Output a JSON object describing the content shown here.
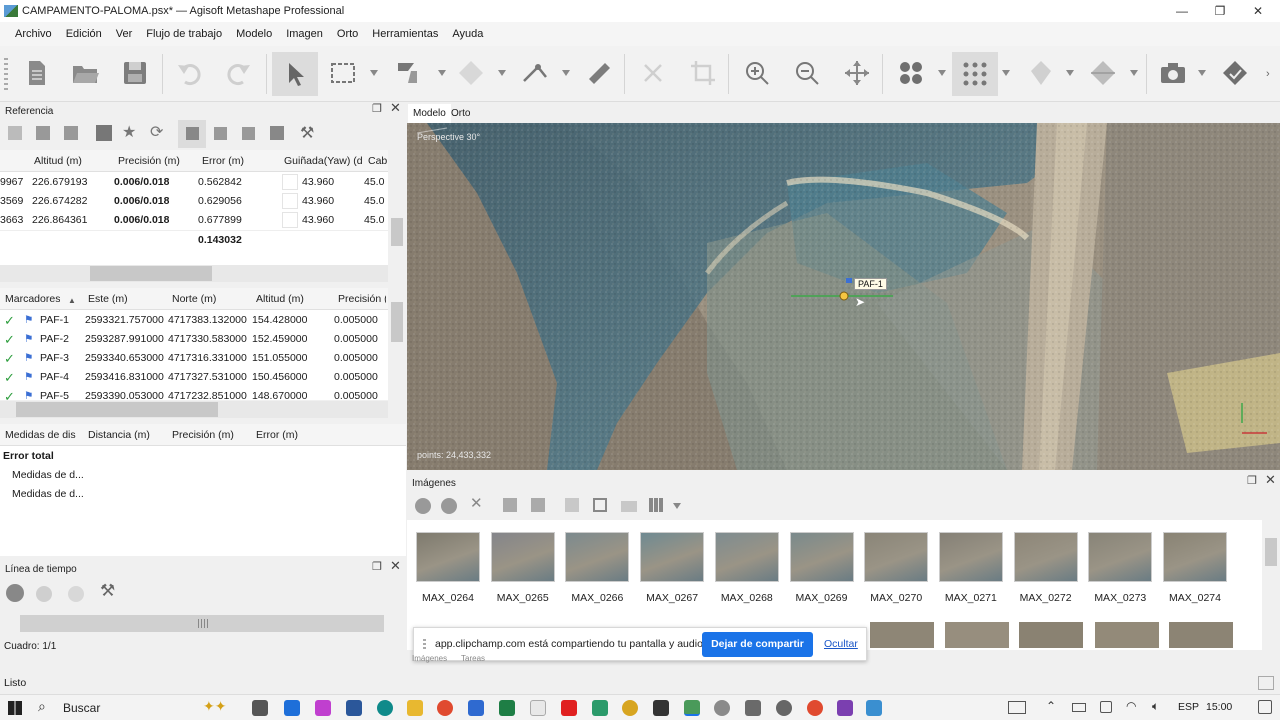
{
  "window": {
    "title": "CAMPAMENTO-PALOMA.psx* — Agisoft Metashape Professional",
    "minimize": "—",
    "maximize": "❐",
    "close": "✕"
  },
  "menu": [
    "Archivo",
    "Edición",
    "Ver",
    "Flujo de trabajo",
    "Modelo",
    "Imagen",
    "Orto",
    "Herramientas",
    "Ayuda"
  ],
  "reference_panel": {
    "title": "Referencia",
    "cameras_table": {
      "columns": [
        "Altitud (m)",
        "Precisión (m)",
        "Error (m)",
        "Guiñada(Yaw) (d",
        "Cab"
      ],
      "rows": [
        {
          "prefix": "9967",
          "altitud": "226.679193",
          "precision": "0.006/0.018",
          "error": "0.562842",
          "yaw": "43.960",
          "cab": "45.0"
        },
        {
          "prefix": "3569",
          "altitud": "226.674282",
          "precision": "0.006/0.018",
          "error": "0.629056",
          "yaw": "43.960",
          "cab": "45.0"
        },
        {
          "prefix": "3663",
          "altitud": "226.864361",
          "precision": "0.006/0.018",
          "error": "0.677899",
          "yaw": "43.960",
          "cab": "45.0"
        }
      ],
      "total_error": "0.143032"
    },
    "markers_table": {
      "columns": [
        "Marcadores",
        "Este (m)",
        "Norte (m)",
        "Altitud (m)",
        "Precisión ("
      ],
      "rows": [
        {
          "name": "PAF-1",
          "este": "2593321.757000",
          "norte": "4717383.132000",
          "altitud": "154.428000",
          "precision": "0.005000"
        },
        {
          "name": "PAF-2",
          "este": "2593287.991000",
          "norte": "4717330.583000",
          "altitud": "152.459000",
          "precision": "0.005000"
        },
        {
          "name": "PAF-3",
          "este": "2593340.653000",
          "norte": "4717316.331000",
          "altitud": "151.055000",
          "precision": "0.005000"
        },
        {
          "name": "PAF-4",
          "este": "2593416.831000",
          "norte": "4717327.531000",
          "altitud": "150.456000",
          "precision": "0.005000"
        },
        {
          "name": "PAF-5",
          "este": "2593390.053000",
          "norte": "4717232.851000",
          "altitud": "148.670000",
          "precision": "0.005000"
        }
      ]
    },
    "scale_table": {
      "columns": [
        "Medidas de dis",
        "Distancia (m)",
        "Precisión (m)",
        "Error (m)"
      ],
      "total_label": "Error total",
      "rows": [
        "Medidas de d...",
        "Medidas de d..."
      ]
    }
  },
  "timeline_panel": {
    "title": "Línea de tiempo",
    "frame": "Cuadro: 1/1"
  },
  "view_tabs": [
    "Modelo",
    "Orto"
  ],
  "viewport": {
    "projection": "Perspective 30°",
    "points": "points: 24,433,332",
    "marker_label": "PAF-1"
  },
  "images_panel": {
    "title": "Imágenes",
    "images": [
      "MAX_0264",
      "MAX_0265",
      "MAX_0266",
      "MAX_0267",
      "MAX_0268",
      "MAX_0269",
      "MAX_0270",
      "MAX_0271",
      "MAX_0272",
      "MAX_0273",
      "MAX_0274"
    ],
    "bottom_tabs": [
      "Imágenes",
      "Tareas"
    ]
  },
  "share_bar": {
    "message": "app.clipchamp.com está compartiendo tu pantalla y audio.",
    "stop_button": "Dejar de compartir",
    "hide_link": "Ocultar"
  },
  "status": "Listo",
  "taskbar": {
    "search_placeholder": "Buscar",
    "language": "ESP",
    "time": "15:00"
  },
  "colors": {
    "accent_blue": "#1a73e8",
    "check_green": "#2e9e3e",
    "flag_blue": "#3b6fd4"
  }
}
